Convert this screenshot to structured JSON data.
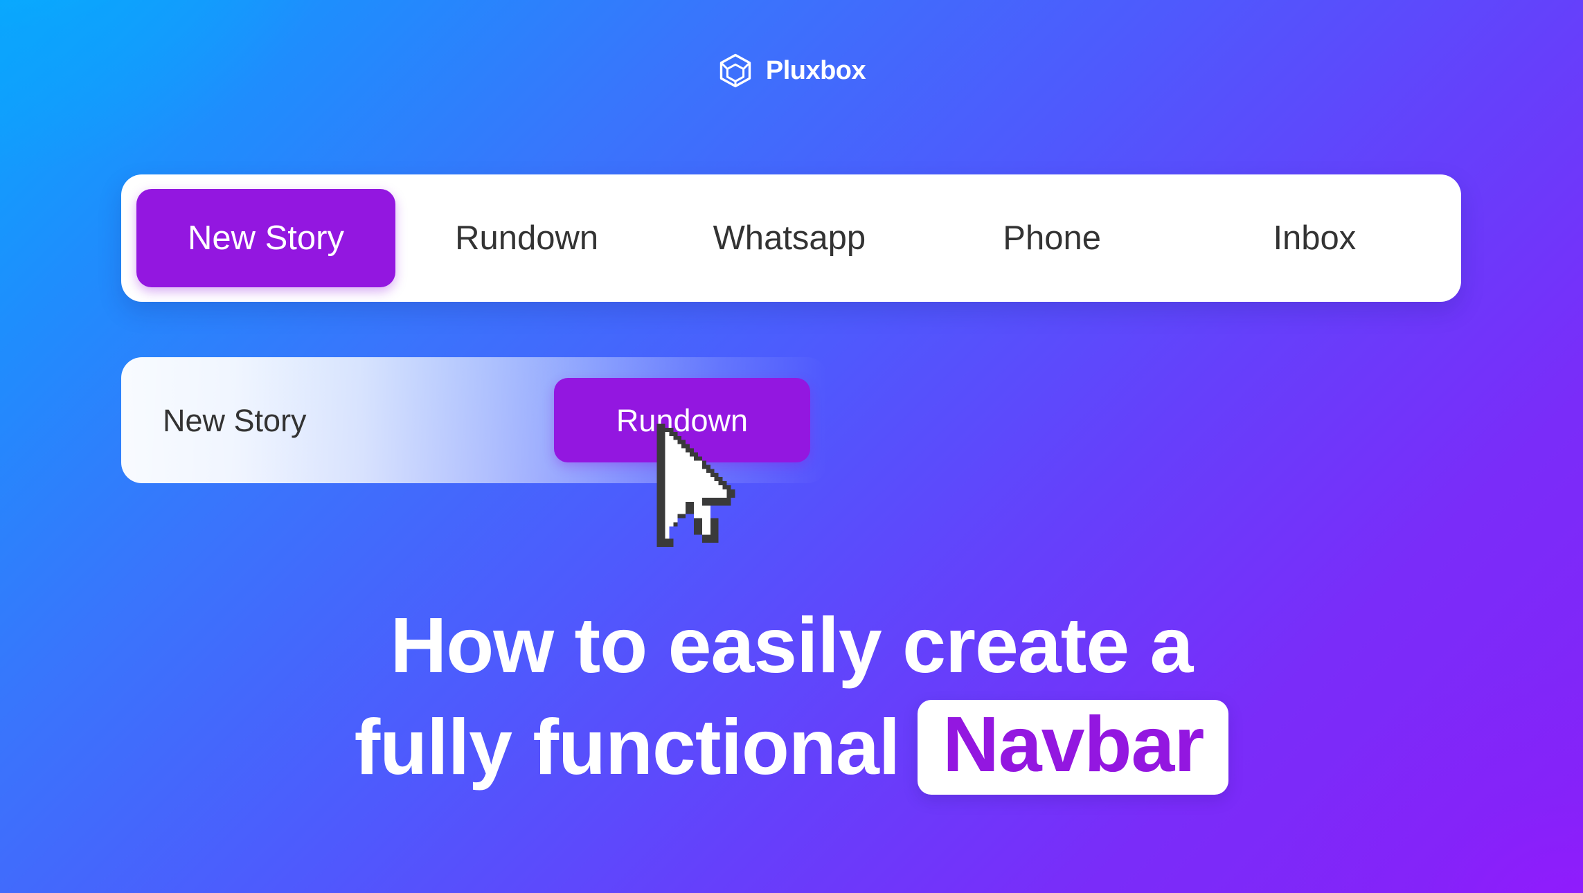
{
  "brand": {
    "name": "Pluxbox",
    "logo_icon": "cube-icon",
    "logo_color": "#ffffff"
  },
  "theme": {
    "accent_purple": "#9317e0",
    "bg_top_left": "#0aa6fd",
    "bg_top_right": "#544efd",
    "bg_bottom_left": "#4f52fd",
    "bg_bottom_right": "#8522f8",
    "card_background": "#ffffff",
    "nav_text": "#333333"
  },
  "navbar": {
    "items": [
      {
        "label": "New Story",
        "active": true
      },
      {
        "label": "Rundown",
        "active": false
      },
      {
        "label": "Whatsapp",
        "active": false
      },
      {
        "label": "Phone",
        "active": false
      },
      {
        "label": "Inbox",
        "active": false
      }
    ]
  },
  "subbar": {
    "items": [
      {
        "label": "New Story",
        "active": false
      },
      {
        "label": "Rundown",
        "active": true
      }
    ]
  },
  "cursor": {
    "icon": "arrow-cursor-icon"
  },
  "headline": {
    "line1": "How to easily create a",
    "line2_prefix": "fully functional",
    "line2_badge": "Navbar"
  }
}
